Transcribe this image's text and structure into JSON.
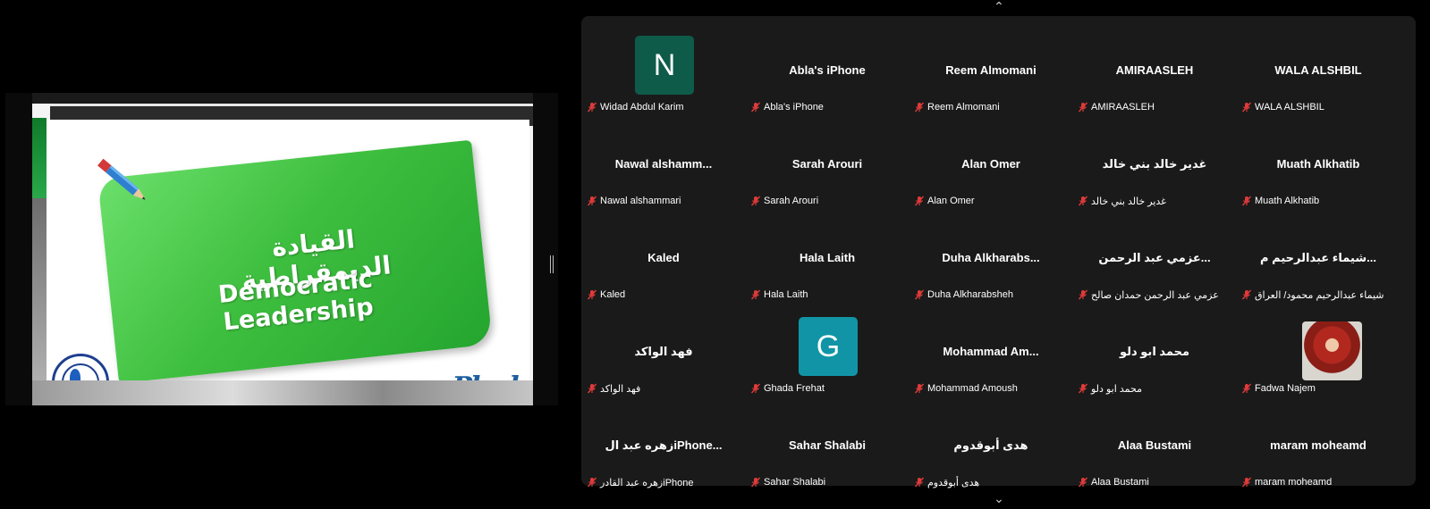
{
  "share": {
    "slide_title_ar": "القيادة الديمقراطية",
    "slide_title_en": "Democratic Leadership",
    "logo_right_text": "aPhrd"
  },
  "gallery": {
    "tiles": [
      {
        "display": "",
        "avatar_letter": "N",
        "avatar_color": "#0f5b4a",
        "label": "Widad Abdul Karim"
      },
      {
        "display": "Abla's iPhone",
        "label": "Abla's iPhone"
      },
      {
        "display": "Reem Almomani",
        "label": "Reem Almomani"
      },
      {
        "display": "AMIRAASLEH",
        "label": "AMIRAASLEH"
      },
      {
        "display": "WALA ALSHBIL",
        "label": "WALA ALSHBIL"
      },
      {
        "display": "Nawal  alshamm...",
        "label": "Nawal alshammari"
      },
      {
        "display": "Sarah Arouri",
        "label": "Sarah Arouri"
      },
      {
        "display": "Alan Omer",
        "label": "Alan Omer"
      },
      {
        "display": "غدير خالد بني خالد",
        "label": "غدير خالد بني خالد"
      },
      {
        "display": "Muath Alkhatib",
        "label": "Muath Alkhatib"
      },
      {
        "display": "Kaled",
        "label": "Kaled"
      },
      {
        "display": "Hala Laith",
        "label": "Hala Laith"
      },
      {
        "display": "Duha  Alkharabs...",
        "label": "Duha Alkharabsheh"
      },
      {
        "display": "عزمي عبد الرحمن...",
        "label": "عزمي عبد الرحمن حمدان صالح"
      },
      {
        "display": "شيماء عبدالرحيم م...",
        "label": "شيماء عبدالرحيم محمود/ العراق"
      },
      {
        "display": "فهد الواكد",
        "label": "فهد الواكد"
      },
      {
        "display": "",
        "avatar_letter": "G",
        "avatar_color": "#1195a6",
        "label": "Ghada Frehat"
      },
      {
        "display": "Mohammad  Am...",
        "label": "Mohammad Amoush"
      },
      {
        "display": "محمد ابو دلو",
        "label": "محمد ابو دلو"
      },
      {
        "display": "",
        "photo": true,
        "label": "Fadwa Najem"
      },
      {
        "display": "زهره عبد الiPhone...",
        "label": "زهره عبد القادرiPhone"
      },
      {
        "display": "Sahar Shalabi",
        "label": "Sahar Shalabi"
      },
      {
        "display": "هدى أبوقدوم",
        "label": "هدى أبوقدوم"
      },
      {
        "display": "Alaa Bustami",
        "label": "Alaa Bustami"
      },
      {
        "display": "maram moheamd",
        "label": "maram moheamd"
      }
    ]
  },
  "colors": {
    "mute": "#e03a3a",
    "gallery_bg": "#1a1a1a"
  }
}
